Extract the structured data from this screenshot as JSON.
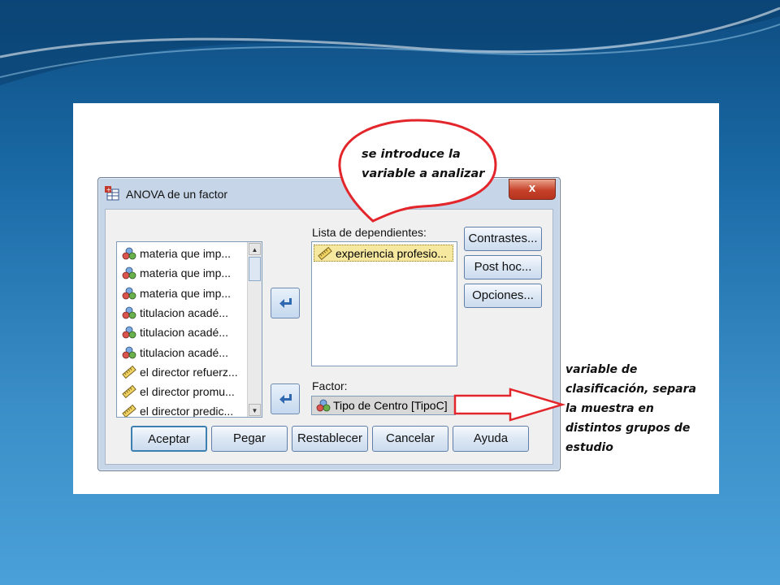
{
  "dialog": {
    "title": "ANOVA de un factor",
    "close_label": "x",
    "source_list": [
      {
        "icon": "nominal-variable-icon",
        "label": "materia que imp..."
      },
      {
        "icon": "nominal-variable-icon",
        "label": "materia que imp..."
      },
      {
        "icon": "nominal-variable-icon",
        "label": "materia que imp..."
      },
      {
        "icon": "nominal-variable-icon",
        "label": "titulacion acadé..."
      },
      {
        "icon": "nominal-variable-icon",
        "label": "titulacion acadé..."
      },
      {
        "icon": "nominal-variable-icon",
        "label": "titulacion acadé..."
      },
      {
        "icon": "scale-variable-icon",
        "label": "el director refuerz..."
      },
      {
        "icon": "scale-variable-icon",
        "label": "el director promu..."
      },
      {
        "icon": "scale-variable-icon",
        "label": "el director predic..."
      }
    ],
    "dependents_label": "Lista de dependientes:",
    "dependents": [
      {
        "icon": "scale-variable-icon",
        "label": "experiencia profesio..."
      }
    ],
    "factor_label": "Factor:",
    "factor_value": "Tipo de Centro [TipoC]",
    "side_buttons": {
      "contrasts": "Contrastes...",
      "post_hoc": "Post hoc...",
      "options": "Opciones..."
    },
    "bottom_buttons": {
      "ok": "Aceptar",
      "paste": "Pegar",
      "reset": "Restablecer",
      "cancel": "Cancelar",
      "help": "Ayuda"
    }
  },
  "annotations": {
    "bubble_line1": "se introduce la",
    "bubble_line2": "variable a analizar",
    "factor_note": "variable de clasificación, separa la muestra en distintos grupos de estudio"
  },
  "colors": {
    "annotation_red": "#e3262b",
    "highlight_yellow": "#f7e8a0"
  }
}
